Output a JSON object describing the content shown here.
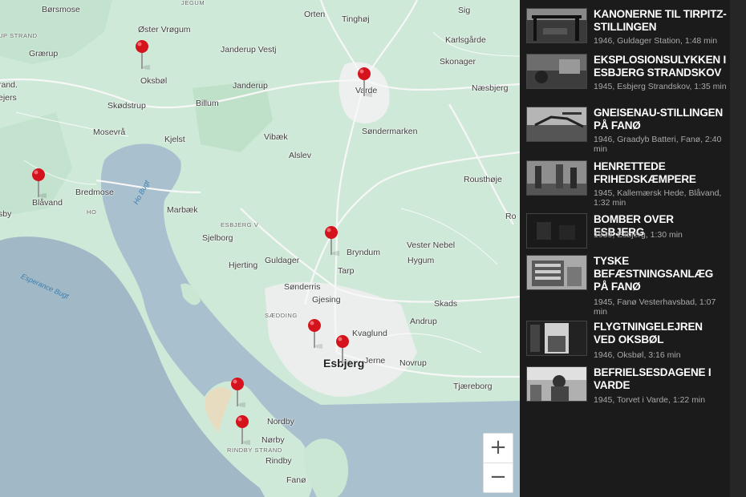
{
  "colors": {
    "land": "#cfe9d8",
    "water": "#a9c0cf",
    "sea": "#9fb6c4",
    "city": "#eceeee",
    "panel": "#1b1b1b",
    "pin": "#d4131d",
    "beach": "#e8dcc0"
  },
  "map": {
    "places": [
      {
        "name": "Børsmose"
      },
      {
        "name": "JEGUM"
      },
      {
        "name": "UP STRAND"
      },
      {
        "name": "Grærup"
      },
      {
        "name": "Øster Vrøgum"
      },
      {
        "name": "Orten"
      },
      {
        "name": "Tinghøj"
      },
      {
        "name": "Sig"
      },
      {
        "name": "Karlsgårde"
      },
      {
        "name": "Janderup Vestj"
      },
      {
        "name": "Skonager"
      },
      {
        "name": "Oksbøl"
      },
      {
        "name": "Janderup"
      },
      {
        "name": "Varde"
      },
      {
        "name": "Næsbjerg"
      },
      {
        "name": "rand."
      },
      {
        "name": "ejers"
      },
      {
        "name": "Skødstrup"
      },
      {
        "name": "Billum"
      },
      {
        "name": "Søndermarken"
      },
      {
        "name": "Mosevrå"
      },
      {
        "name": "Kjelst"
      },
      {
        "name": "Vibæk"
      },
      {
        "name": "Alslev"
      },
      {
        "name": "Rousthøje"
      },
      {
        "name": "Blåvand"
      },
      {
        "name": "Bredmose"
      },
      {
        "name": "HO"
      },
      {
        "name": "sby"
      },
      {
        "name": "Marbæk"
      },
      {
        "name": "Ro"
      },
      {
        "name": "ESBJERG V"
      },
      {
        "name": "Sjelborg"
      },
      {
        "name": "Bryndum"
      },
      {
        "name": "Vester Nebel"
      },
      {
        "name": "Hjerting"
      },
      {
        "name": "Guldager"
      },
      {
        "name": "Hygum"
      },
      {
        "name": "Tarp"
      },
      {
        "name": "Sønderris"
      },
      {
        "name": "Gjesing"
      },
      {
        "name": "Skads"
      },
      {
        "name": "SÆDDING"
      },
      {
        "name": "Andrup"
      },
      {
        "name": "Kvaglund"
      },
      {
        "name": "Esbjerg"
      },
      {
        "name": "Jerne"
      },
      {
        "name": "Novrup"
      },
      {
        "name": "Tjæreborg"
      },
      {
        "name": "Nordby"
      },
      {
        "name": "Nørby"
      },
      {
        "name": "RINDBY STRAND"
      },
      {
        "name": "Rindby"
      },
      {
        "name": "Fanø"
      }
    ],
    "water_labels": [
      {
        "name": "Ho Bugt"
      },
      {
        "name": "Esperance Bugt"
      }
    ],
    "zoom_in": "+",
    "zoom_out": "−"
  },
  "films": [
    {
      "title": "KANONERNE TIL TIRPITZ-STILLINGEN",
      "meta": "1946, Guldager Station, 1:48 min"
    },
    {
      "title": "EKSPLOSIONSULYKKEN I ESBJERG STRANDSKOV",
      "meta": "1945, Esbjerg Strandskov, 1:35 min"
    },
    {
      "title": "GNEISENAU-STILLINGEN PÅ FANØ",
      "meta": "1946, Graadyb Batteri, Fanø, 2:40 min"
    },
    {
      "title": "HENRETTEDE FRIHEDSKÆMPERE",
      "meta": "1945, Kallemærsk Hede, Blåvand, 1:32 min"
    },
    {
      "title": "BOMBER OVER ESBJERG",
      "meta": "1939, Esbjerg, 1:30 min"
    },
    {
      "title": "TYSKE BEFÆSTNINGSANLÆG PÅ FANØ",
      "meta": "1945, Fanø Vesterhavsbad, 1:07 min"
    },
    {
      "title": "FLYGTNINGELEJREN VED OKSBØL",
      "meta": "1946, Oksbøl, 3:16 min"
    },
    {
      "title": "BEFRIELSESDAGENE I VARDE",
      "meta": "1945, Torvet i Varde, 1:22 min"
    }
  ]
}
